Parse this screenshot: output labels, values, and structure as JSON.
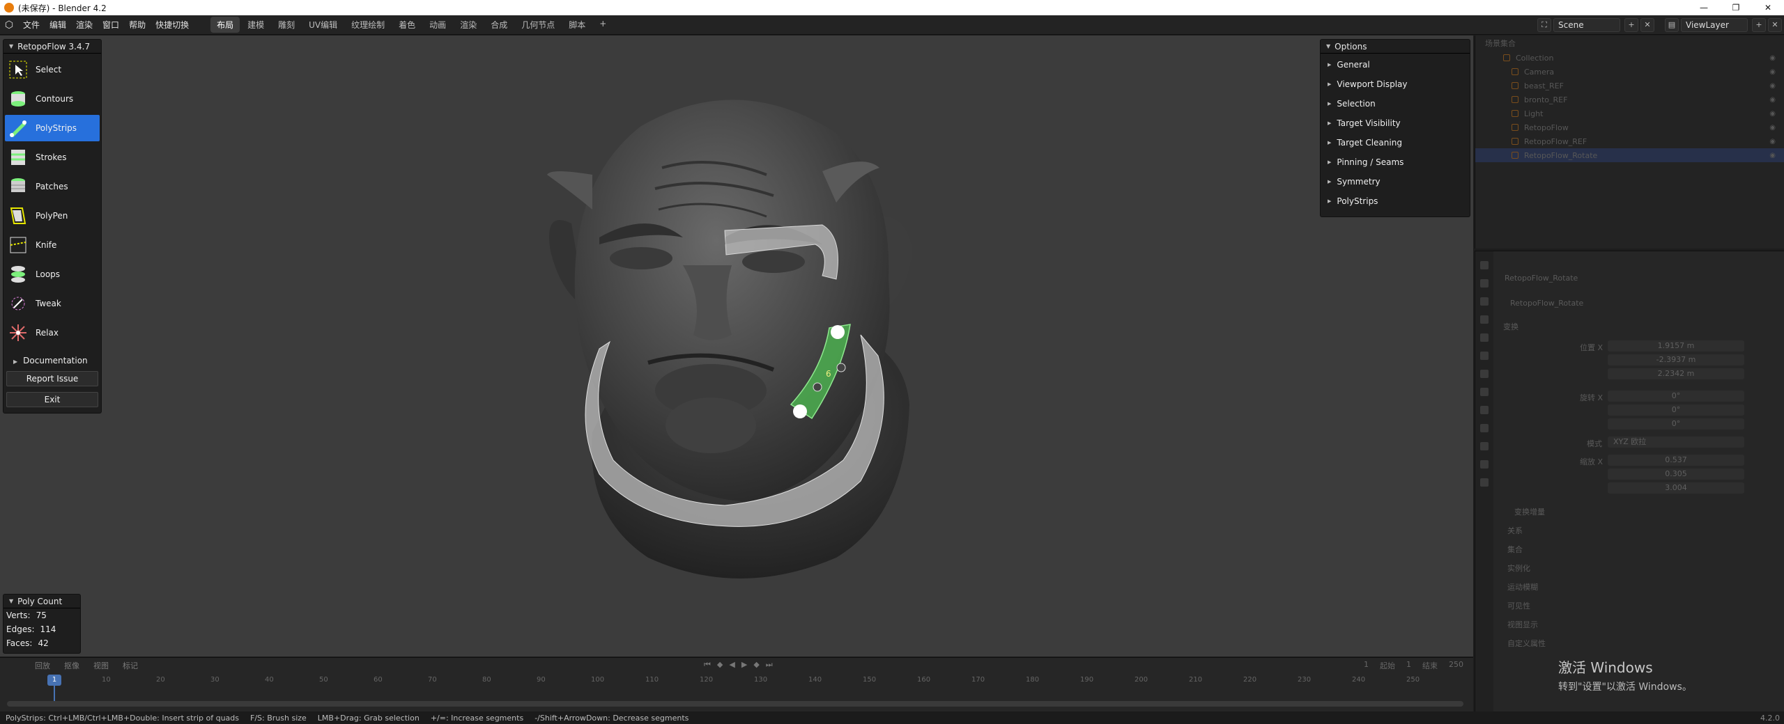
{
  "titlebar": {
    "title": "(未保存) - Blender 4.2",
    "min": "—",
    "max": "❐",
    "close": "✕"
  },
  "menubar": {
    "menus": [
      "文件",
      "编辑",
      "渲染",
      "窗口",
      "帮助",
      "快捷切换"
    ],
    "workspaces": [
      "布局",
      "建模",
      "雕刻",
      "UV编辑",
      "纹理绘制",
      "着色",
      "动画",
      "渲染",
      "合成",
      "几何节点",
      "脚本",
      "+"
    ],
    "active_workspace": "布局",
    "scene": "Scene",
    "view_layer": "ViewLayer"
  },
  "tools_panel": {
    "title": "RetopoFlow 3.4.7",
    "tools": [
      {
        "label": "Select",
        "icon": "select-icon"
      },
      {
        "label": "Contours",
        "icon": "contours-icon"
      },
      {
        "label": "PolyStrips",
        "icon": "polystrips-icon",
        "active": true
      },
      {
        "label": "Strokes",
        "icon": "strokes-icon"
      },
      {
        "label": "Patches",
        "icon": "patches-icon"
      },
      {
        "label": "PolyPen",
        "icon": "polypen-icon"
      },
      {
        "label": "Knife",
        "icon": "knife-icon"
      },
      {
        "label": "Loops",
        "icon": "loops-icon"
      },
      {
        "label": "Tweak",
        "icon": "tweak-icon"
      },
      {
        "label": "Relax",
        "icon": "relax-icon"
      }
    ],
    "documentation": "Documentation",
    "report_issue": "Report Issue",
    "exit": "Exit"
  },
  "options_panel": {
    "title": "Options",
    "items": [
      "General",
      "Viewport Display",
      "Selection",
      "Target Visibility",
      "Target Cleaning",
      "Pinning / Seams",
      "Symmetry",
      "PolyStrips"
    ]
  },
  "poly_count": {
    "title": "Poly Count",
    "verts_label": "Verts:",
    "verts": "75",
    "edges_label": "Edges:",
    "edges": "114",
    "faces_label": "Faces:",
    "faces": "42"
  },
  "viewport": {
    "strip_label": "6"
  },
  "timeline": {
    "header": [
      "回放",
      "抠像",
      "视图",
      "标记"
    ],
    "current_frame": "1",
    "ticks": [
      "10",
      "20",
      "30",
      "40",
      "50",
      "60",
      "70",
      "80",
      "90",
      "100",
      "110",
      "120",
      "130",
      "140",
      "150",
      "160",
      "170",
      "180",
      "190",
      "200",
      "210",
      "220",
      "230",
      "240",
      "250"
    ],
    "start_label": "起始",
    "start": "1",
    "end_label": "结束",
    "end": "250",
    "frame_field": "1"
  },
  "statusbar": {
    "hints": [
      "PolyStrips: Ctrl+LMB/Ctrl+LMB+Double: Insert strip of quads",
      "F/S: Brush size",
      "LMB+Drag: Grab selection",
      "+/=: Increase segments",
      "-/Shift+ArrowDown: Decrease segments"
    ],
    "version": "4.2.0"
  },
  "outliner": {
    "header": "场景集合",
    "rows": [
      "Collection",
      "Camera",
      "beast_REF",
      "bronto_REF",
      "Light",
      "RetopoFlow",
      "RetopoFlow_REF",
      "RetopoFlow_Rotate"
    ]
  },
  "properties": {
    "object_name": "RetopoFlow_Rotate",
    "object_name2": "RetopoFlow_Rotate",
    "section_transform": "变换",
    "loc_label": "位置 X",
    "loc_x": "1.9157 m",
    "loc_y": "-2.3937 m",
    "loc_z": "2.2342 m",
    "rot_label": "旋转 X",
    "rot_x": "0°",
    "rot_y": "0°",
    "rot_z": "0°",
    "mode_label": "模式",
    "mode": "XYZ 欧拉",
    "scale_label": "缩放 X",
    "scale_x": "0.537",
    "scale_y": "0.305",
    "scale_z": "3.004",
    "sections": [
      "变换增量",
      "关系",
      "集合",
      "实例化",
      "运动模糊",
      "可见性",
      "视图显示",
      "自定义属性"
    ]
  },
  "watermark": {
    "line1": "激活 Windows",
    "line2": "转到\"设置\"以激活 Windows。"
  }
}
